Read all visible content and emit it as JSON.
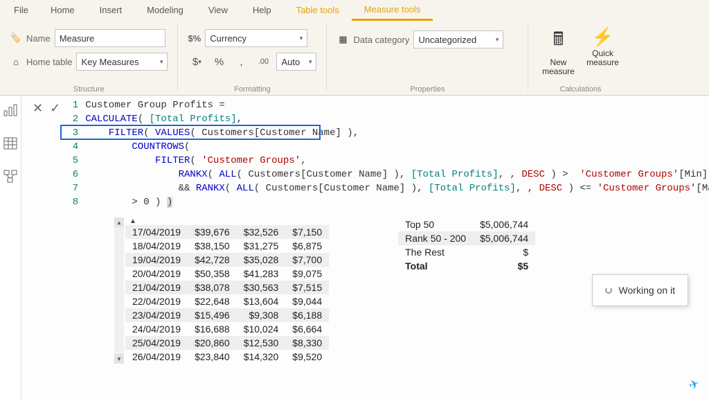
{
  "tabs": {
    "file": "File",
    "home": "Home",
    "insert": "Insert",
    "modeling": "Modeling",
    "view": "View",
    "help": "Help",
    "table_tools": "Table tools",
    "measure_tools": "Measure tools"
  },
  "structure": {
    "name_label": "Name",
    "name_value": "Measure",
    "hometable_label": "Home table",
    "hometable_value": "Key Measures",
    "group": "Structure"
  },
  "formatting": {
    "format_label": "$%",
    "format_value": "Currency",
    "auto": "Auto",
    "group": "Formatting"
  },
  "properties": {
    "datacat_label": "Data category",
    "datacat_value": "Uncategorized",
    "group": "Properties"
  },
  "calculations": {
    "new_measure": "New\nmeasure",
    "quick_measure": "Quick\nmeasure",
    "group": "Calculations"
  },
  "formula": {
    "lines": [
      "Customer Group Profits =",
      "CALCULATE( [Total Profits],",
      "    FILTER( VALUES( Customers[Customer Name] ),",
      "        COUNTROWS(",
      "            FILTER( 'Customer Groups',",
      "                RANKX( ALL( Customers[Customer Name] ), [Total Profits], , DESC ) >  'Customer Groups'[Min]",
      "                && RANKX( ALL( Customers[Customer Name] ), [Total Profits], , DESC ) <= 'Customer Groups'[Max] ) )",
      "        > 0 ) )"
    ]
  },
  "left_table": [
    [
      "17/04/2019",
      "$39,676",
      "$32,526",
      "$7,150"
    ],
    [
      "18/04/2019",
      "$38,150",
      "$31,275",
      "$6,875"
    ],
    [
      "19/04/2019",
      "$42,728",
      "$35,028",
      "$7,700"
    ],
    [
      "20/04/2019",
      "$50,358",
      "$41,283",
      "$9,075"
    ],
    [
      "21/04/2019",
      "$38,078",
      "$30,563",
      "$7,515"
    ],
    [
      "22/04/2019",
      "$22,648",
      "$13,604",
      "$9,044"
    ],
    [
      "23/04/2019",
      "$15,496",
      "$9,308",
      "$6,188"
    ],
    [
      "24/04/2019",
      "$16,688",
      "$10,024",
      "$6,664"
    ],
    [
      "25/04/2019",
      "$20,860",
      "$12,530",
      "$8,330"
    ],
    [
      "26/04/2019",
      "$23,840",
      "$14,320",
      "$9,520"
    ]
  ],
  "right_table": [
    [
      "Top 50",
      "$5,006,744"
    ],
    [
      "Rank 50 - 200",
      "$5,006,744"
    ],
    [
      "The Rest",
      "$"
    ],
    [
      "Total",
      "$5"
    ]
  ],
  "tooltip": "Working on it"
}
